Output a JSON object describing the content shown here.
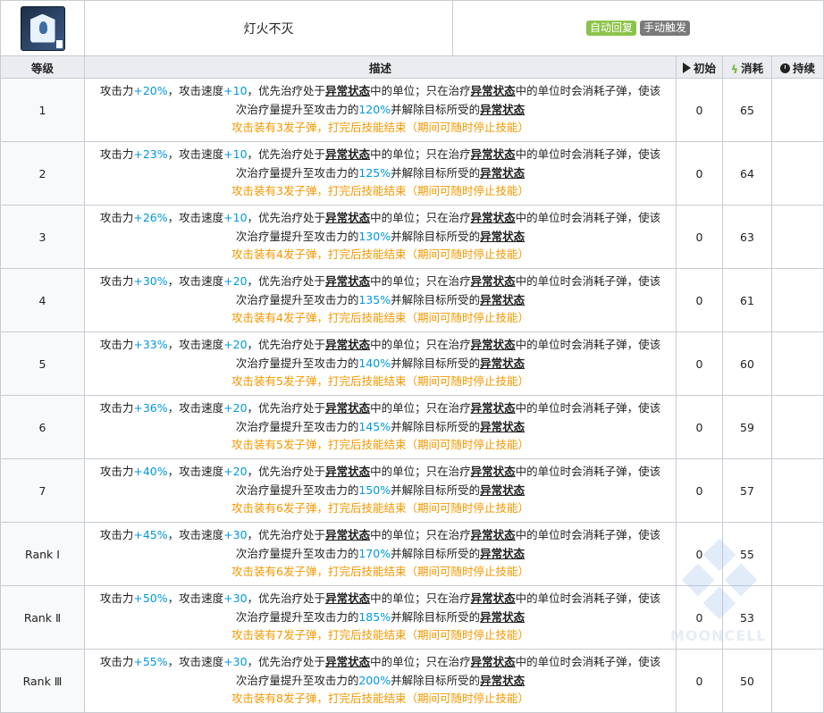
{
  "skill": {
    "name": "灯火不灭",
    "icon": "lantern-skill-icon",
    "tags": [
      "自动回复",
      "手动触发"
    ]
  },
  "columns": {
    "level": "等级",
    "description": "描述",
    "initial": "初始",
    "cost": "消耗",
    "duration": "持续"
  },
  "text": {
    "a1": "攻击力",
    "a2": "，攻击速度",
    "a3": "，优先治疗处于",
    "status": "异常状态",
    "a4": "中的单位；只在治疗",
    "a5": "中的单位时会消耗子弹，使该",
    "b1": "次治疗量提升至攻击力的",
    "b2": "并解除目标所受的",
    "c1": "攻击装有",
    "c2": "发子弹，打完后技能结束（期间可随时停止技能）"
  },
  "rows": [
    {
      "level": "1",
      "atk": "+20%",
      "aspd": "+10",
      "heal": "120%",
      "ammo": "3",
      "initial": "0",
      "cost": "65",
      "duration": ""
    },
    {
      "level": "2",
      "atk": "+23%",
      "aspd": "+10",
      "heal": "125%",
      "ammo": "3",
      "initial": "0",
      "cost": "64",
      "duration": ""
    },
    {
      "level": "3",
      "atk": "+26%",
      "aspd": "+10",
      "heal": "130%",
      "ammo": "4",
      "initial": "0",
      "cost": "63",
      "duration": ""
    },
    {
      "level": "4",
      "atk": "+30%",
      "aspd": "+20",
      "heal": "135%",
      "ammo": "4",
      "initial": "0",
      "cost": "61",
      "duration": ""
    },
    {
      "level": "5",
      "atk": "+33%",
      "aspd": "+20",
      "heal": "140%",
      "ammo": "5",
      "initial": "0",
      "cost": "60",
      "duration": ""
    },
    {
      "level": "6",
      "atk": "+36%",
      "aspd": "+20",
      "heal": "145%",
      "ammo": "5",
      "initial": "0",
      "cost": "59",
      "duration": ""
    },
    {
      "level": "7",
      "atk": "+40%",
      "aspd": "+20",
      "heal": "150%",
      "ammo": "6",
      "initial": "0",
      "cost": "57",
      "duration": ""
    },
    {
      "level": "Rank Ⅰ",
      "atk": "+45%",
      "aspd": "+30",
      "heal": "170%",
      "ammo": "6",
      "initial": "0",
      "cost": "55",
      "duration": ""
    },
    {
      "level": "Rank Ⅱ",
      "atk": "+50%",
      "aspd": "+30",
      "heal": "185%",
      "ammo": "7",
      "initial": "0",
      "cost": "53",
      "duration": ""
    },
    {
      "level": "Rank Ⅲ",
      "atk": "+55%",
      "aspd": "+30",
      "heal": "200%",
      "ammo": "8",
      "initial": "0",
      "cost": "50",
      "duration": ""
    }
  ],
  "watermark": "MOONCELL",
  "colors": {
    "value_blue": "#0098dc",
    "ammo_orange": "#f49800",
    "tag_auto": "#8bc34a",
    "tag_manual": "#7a7a7a",
    "header_bg": "#eaecf0"
  }
}
